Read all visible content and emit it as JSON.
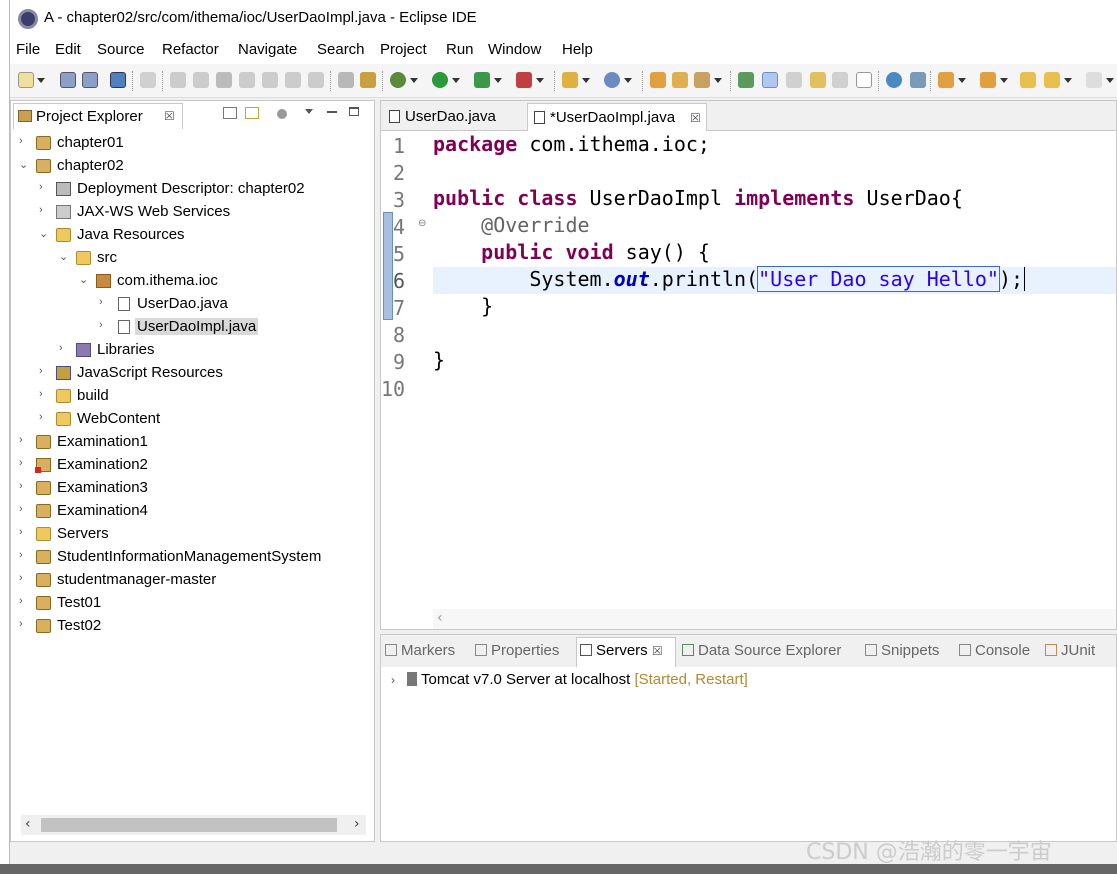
{
  "window": {
    "title": "A - chapter02/src/com/ithema/ioc/UserDaoImpl.java - Eclipse IDE"
  },
  "menubar": {
    "items": [
      "File",
      "Edit",
      "Source",
      "Refactor",
      "Navigate",
      "Search",
      "Project",
      "Run",
      "Window",
      "Help"
    ]
  },
  "project_explorer": {
    "tab_label": "Project Explorer",
    "close_glyph": "☒",
    "tree": [
      {
        "label": "chapter01",
        "expanded": false
      },
      {
        "label": "chapter02",
        "expanded": true
      },
      {
        "label": "Deployment Descriptor: chapter02"
      },
      {
        "label": "JAX-WS Web Services"
      },
      {
        "label": "Java Resources",
        "expanded": true
      },
      {
        "label": "src",
        "expanded": true
      },
      {
        "label": "com.ithema.ioc",
        "expanded": true
      },
      {
        "label": "UserDao.java"
      },
      {
        "label": "UserDaoImpl.java",
        "selected": true
      },
      {
        "label": "Libraries"
      },
      {
        "label": "JavaScript Resources"
      },
      {
        "label": "build"
      },
      {
        "label": "WebContent"
      },
      {
        "label": "Examination1"
      },
      {
        "label": "Examination2"
      },
      {
        "label": "Examination3"
      },
      {
        "label": "Examination4"
      },
      {
        "label": "Servers"
      },
      {
        "label": "StudentInformationManagementSystem"
      },
      {
        "label": "studentmanager-master"
      },
      {
        "label": "Test01"
      },
      {
        "label": "Test02"
      }
    ]
  },
  "editor": {
    "tabs": [
      {
        "label": "UserDao.java",
        "active": false
      },
      {
        "label": "*UserDaoImpl.java",
        "active": true
      }
    ],
    "line_numbers": [
      "1",
      "2",
      "3",
      "4",
      "5",
      "6",
      "7",
      "8",
      "9",
      "10"
    ],
    "code": {
      "l1_kw": "package",
      "l1_rest": " com.ithema.ioc;",
      "l3_kw1": "public",
      "l3_kw2": "class",
      "l3_mid": " UserDaoImpl ",
      "l3_kw3": "implements",
      "l3_rest": " UserDao{",
      "l4": "    @Override",
      "l5_pad": "    ",
      "l5_kw1": "public",
      "l5_kw2": "void",
      "l5_rest": " say() {",
      "l6_pre": "        System.",
      "l6_field": "out",
      "l6_mid": ".println(",
      "l6_str": "\"User Dao say Hello\"",
      "l6_end": ");",
      "l7": "    }",
      "l9": "}"
    },
    "fold_marker": "⊖"
  },
  "bottom_panel": {
    "tabs": [
      {
        "label": "Markers"
      },
      {
        "label": "Properties"
      },
      {
        "label": "Servers",
        "active": true
      },
      {
        "label": "Data Source Explorer"
      },
      {
        "label": "Snippets"
      },
      {
        "label": "Console"
      },
      {
        "label": "JUnit"
      }
    ],
    "server": {
      "name": "Tomcat v7.0 Server at localhost",
      "status": "[Started, Restart]"
    }
  },
  "watermark": "CSDN @浩瀚的零一宇宙",
  "colors": {
    "keyword": "#7f0055",
    "string": "#2a00ff",
    "field": "#0000c0",
    "current_line": "#e8f2fe"
  }
}
